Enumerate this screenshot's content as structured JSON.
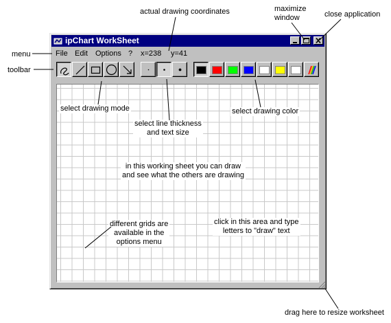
{
  "window": {
    "title": "ipChart WorkSheet"
  },
  "menu": {
    "items": [
      "File",
      "Edit",
      "Options",
      "?"
    ],
    "coord_x": "x=238",
    "coord_y": "y=41"
  },
  "toolbar": {
    "modes": [
      "freehand-icon",
      "line-icon",
      "rectangle-icon",
      "ellipse-icon",
      "arrow-icon"
    ],
    "thickness": [
      "thin",
      "medium",
      "thick"
    ],
    "selected_thickness": "medium",
    "colors": [
      "#000000",
      "#ff0000",
      "#00ff00",
      "#0000ff",
      "#ffffff",
      "#ffff00",
      "#ffffff"
    ],
    "selected_color": "#000000"
  },
  "annotations": {
    "coords": "actual drawing coordinates",
    "maximize": "maximize\nwindow",
    "close": "close application",
    "menu": "menu",
    "toolbar": "toolbar",
    "mode": "select drawing mode",
    "thickness": "select line thickness\nand text size",
    "color": "select drawing color",
    "worksheet": "in this working sheet you can draw\nand see what the others are drawing",
    "grids": "different grids are\navailable in the\noptions menu",
    "text": "click in this area and type\nletters to \"draw\" text",
    "resize": "drag here to resize worksheet"
  }
}
